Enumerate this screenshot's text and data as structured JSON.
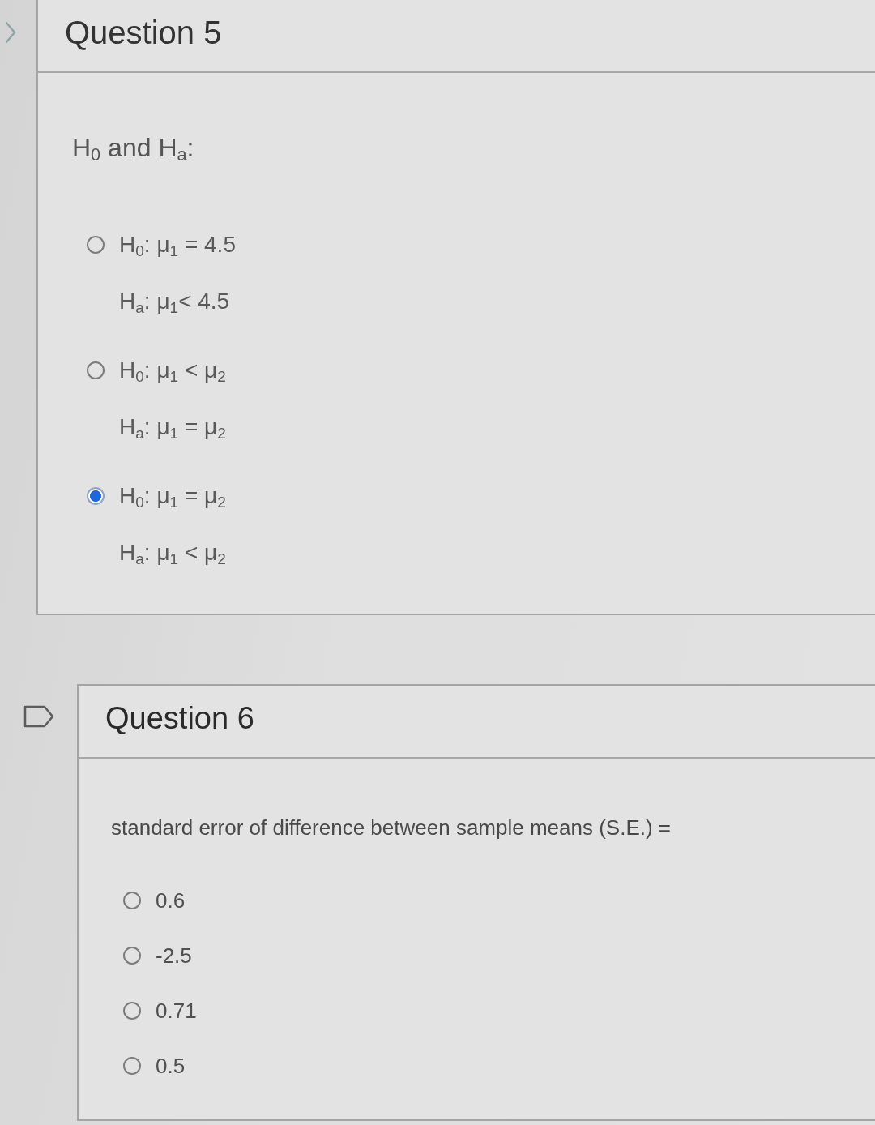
{
  "questions": [
    {
      "title": "Question 5",
      "prompt": "H$_{0}$ and H$_{a}$:",
      "options": [
        {
          "lines": [
            "H$_{0}$: μ$_{1}$ = 4.5",
            "H$_{a}$: μ$_{1}$< 4.5"
          ],
          "selected": false
        },
        {
          "lines": [
            "H$_{0}$: μ$_{1}$ < μ$_{2}$",
            "H$_{a}$: μ$_{1}$ = μ$_{2}$"
          ],
          "selected": false
        },
        {
          "lines": [
            "H$_{0}$: μ$_{1}$ = μ$_{2}$",
            "H$_{a}$: μ$_{1}$ < μ$_{2}$"
          ],
          "selected": true
        }
      ]
    },
    {
      "title": "Question 6",
      "prompt": "standard error of difference between sample means (S.E.) =",
      "options": [
        {
          "lines": [
            "0.6"
          ],
          "selected": false
        },
        {
          "lines": [
            "-2.5"
          ],
          "selected": false
        },
        {
          "lines": [
            "0.71"
          ],
          "selected": false
        },
        {
          "lines": [
            "0.5"
          ],
          "selected": false
        }
      ]
    }
  ]
}
